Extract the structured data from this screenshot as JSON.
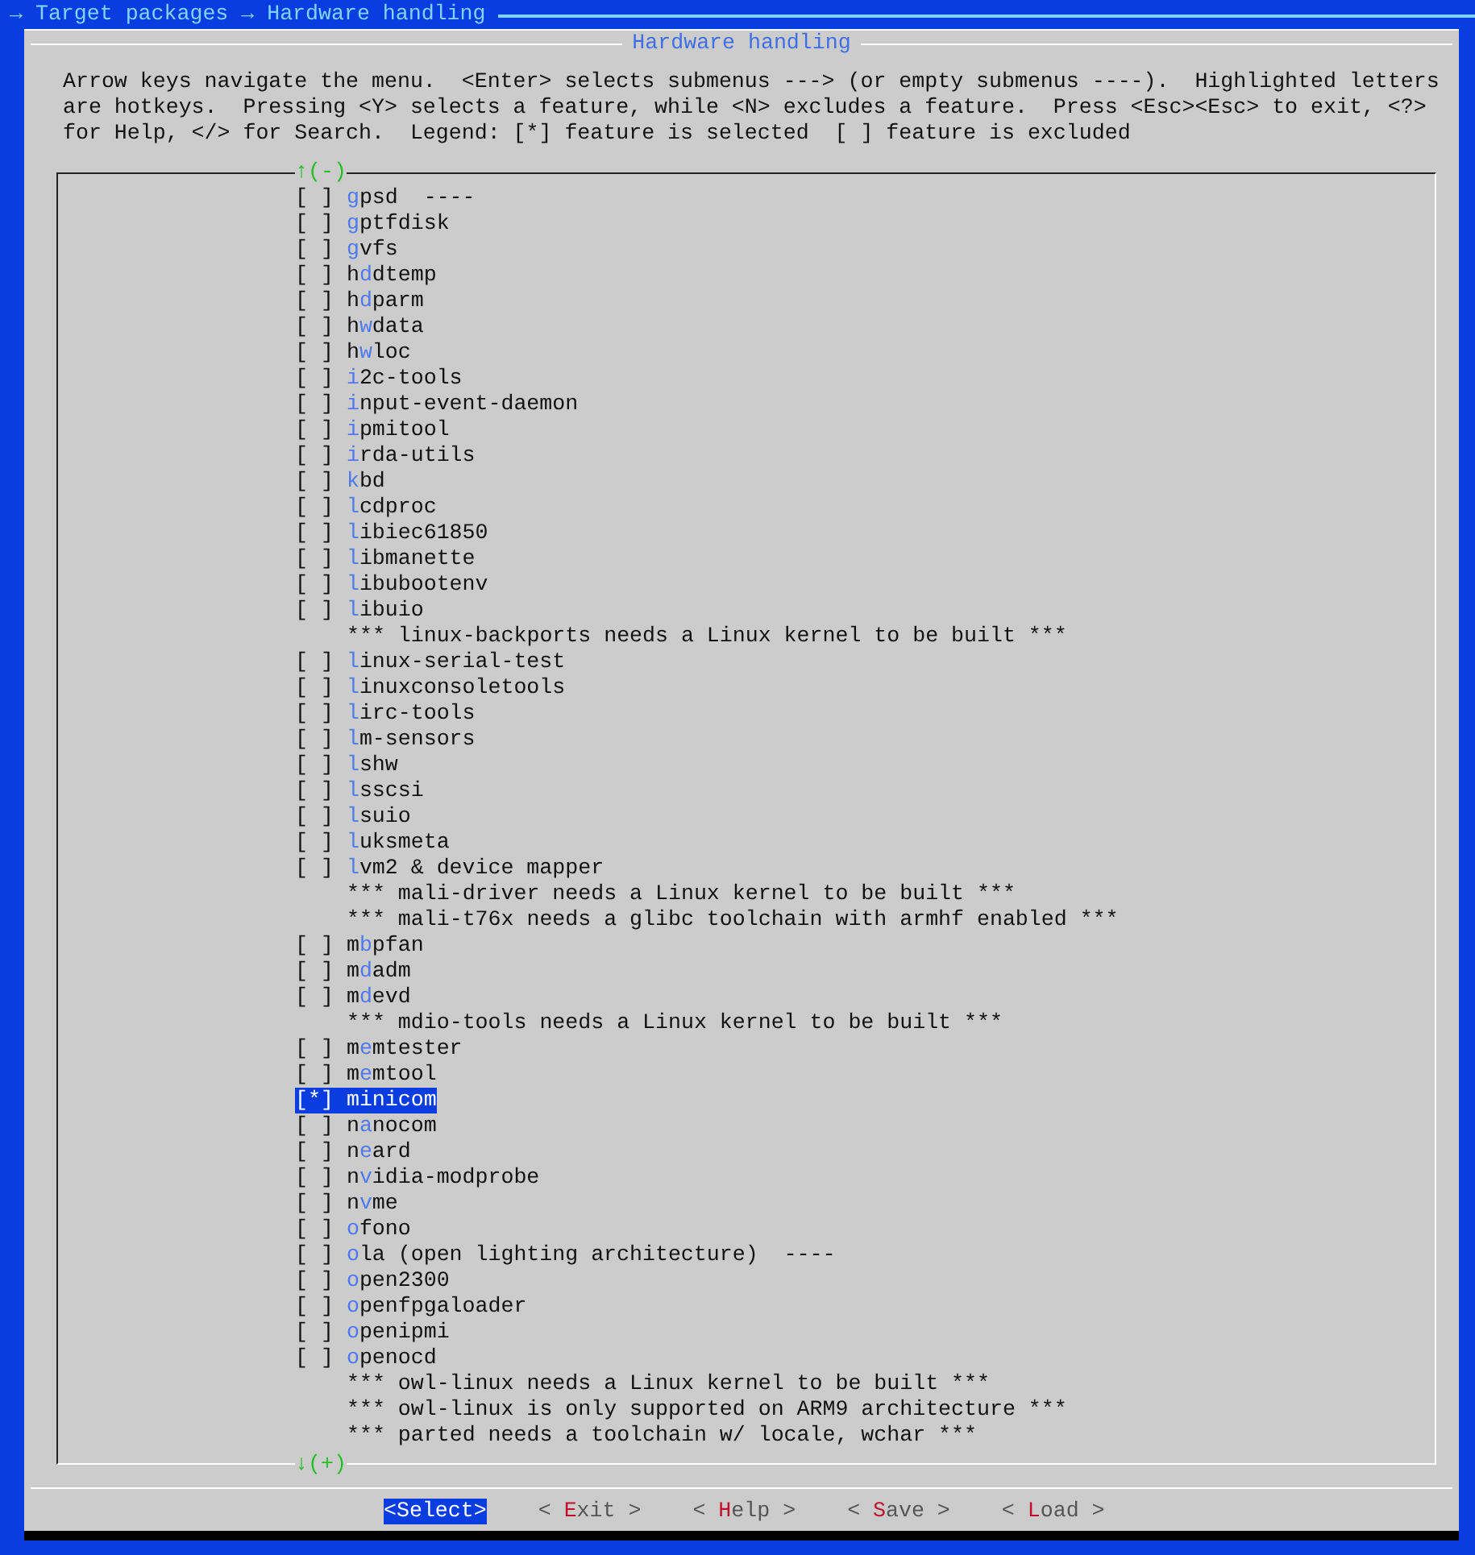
{
  "breadcrumb": "→ Target packages → Hardware handling",
  "dialog": {
    "title": "Hardware handling",
    "help_lines": [
      "Arrow keys navigate the menu.  <Enter> selects submenus ---> (or empty submenus ----).  Highlighted letters",
      "are hotkeys.  Pressing <Y> selects a feature, while <N> excludes a feature.  Press <Esc><Esc> to exit, <?>",
      "for Help, </> for Search.  Legend: [*] feature is selected  [ ] feature is excluded"
    ]
  },
  "scroll_up": "↑(-)",
  "scroll_down": "↓(+)",
  "items": [
    {
      "kind": "option",
      "checkbox": "[ ]",
      "selected": false,
      "hotkey": "g",
      "after": "psd  ----"
    },
    {
      "kind": "option",
      "checkbox": "[ ]",
      "selected": false,
      "hotkey": "g",
      "after": "ptfdisk"
    },
    {
      "kind": "option",
      "checkbox": "[ ]",
      "selected": false,
      "hotkey": "g",
      "after": "vfs"
    },
    {
      "kind": "option",
      "checkbox": "[ ]",
      "selected": false,
      "before": "h",
      "hotkey": "d",
      "after": "dtemp"
    },
    {
      "kind": "option",
      "checkbox": "[ ]",
      "selected": false,
      "before": "h",
      "hotkey": "d",
      "after": "parm"
    },
    {
      "kind": "option",
      "checkbox": "[ ]",
      "selected": false,
      "before": "h",
      "hotkey": "w",
      "after": "data"
    },
    {
      "kind": "option",
      "checkbox": "[ ]",
      "selected": false,
      "before": "h",
      "hotkey": "w",
      "after": "loc"
    },
    {
      "kind": "option",
      "checkbox": "[ ]",
      "selected": false,
      "hotkey": "i",
      "after": "2c-tools"
    },
    {
      "kind": "option",
      "checkbox": "[ ]",
      "selected": false,
      "hotkey": "i",
      "after": "nput-event-daemon"
    },
    {
      "kind": "option",
      "checkbox": "[ ]",
      "selected": false,
      "hotkey": "i",
      "after": "pmitool"
    },
    {
      "kind": "option",
      "checkbox": "[ ]",
      "selected": false,
      "hotkey": "i",
      "after": "rda-utils"
    },
    {
      "kind": "option",
      "checkbox": "[ ]",
      "selected": false,
      "hotkey": "k",
      "after": "bd"
    },
    {
      "kind": "option",
      "checkbox": "[ ]",
      "selected": false,
      "hotkey": "l",
      "after": "cdproc"
    },
    {
      "kind": "option",
      "checkbox": "[ ]",
      "selected": false,
      "hotkey": "l",
      "after": "ibiec61850"
    },
    {
      "kind": "option",
      "checkbox": "[ ]",
      "selected": false,
      "hotkey": "l",
      "after": "ibmanette"
    },
    {
      "kind": "option",
      "checkbox": "[ ]",
      "selected": false,
      "hotkey": "l",
      "after": "ibubootenv"
    },
    {
      "kind": "option",
      "checkbox": "[ ]",
      "selected": false,
      "hotkey": "l",
      "after": "ibuio"
    },
    {
      "kind": "comment",
      "text": "*** linux-backports needs a Linux kernel to be built ***"
    },
    {
      "kind": "option",
      "checkbox": "[ ]",
      "selected": false,
      "hotkey": "l",
      "after": "inux-serial-test"
    },
    {
      "kind": "option",
      "checkbox": "[ ]",
      "selected": false,
      "hotkey": "l",
      "after": "inuxconsoletools"
    },
    {
      "kind": "option",
      "checkbox": "[ ]",
      "selected": false,
      "hotkey": "l",
      "after": "irc-tools"
    },
    {
      "kind": "option",
      "checkbox": "[ ]",
      "selected": false,
      "hotkey": "l",
      "after": "m-sensors"
    },
    {
      "kind": "option",
      "checkbox": "[ ]",
      "selected": false,
      "hotkey": "l",
      "after": "shw"
    },
    {
      "kind": "option",
      "checkbox": "[ ]",
      "selected": false,
      "hotkey": "l",
      "after": "sscsi"
    },
    {
      "kind": "option",
      "checkbox": "[ ]",
      "selected": false,
      "hotkey": "l",
      "after": "suio"
    },
    {
      "kind": "option",
      "checkbox": "[ ]",
      "selected": false,
      "hotkey": "l",
      "after": "uksmeta"
    },
    {
      "kind": "option",
      "checkbox": "[ ]",
      "selected": false,
      "hotkey": "l",
      "after": "vm2 & device mapper"
    },
    {
      "kind": "comment",
      "text": "*** mali-driver needs a Linux kernel to be built ***"
    },
    {
      "kind": "comment",
      "text": "*** mali-t76x needs a glibc toolchain with armhf enabled ***"
    },
    {
      "kind": "option",
      "checkbox": "[ ]",
      "selected": false,
      "before": "m",
      "hotkey": "b",
      "after": "pfan"
    },
    {
      "kind": "option",
      "checkbox": "[ ]",
      "selected": false,
      "before": "m",
      "hotkey": "d",
      "after": "adm"
    },
    {
      "kind": "option",
      "checkbox": "[ ]",
      "selected": false,
      "before": "m",
      "hotkey": "d",
      "after": "evd"
    },
    {
      "kind": "comment",
      "text": "*** mdio-tools needs a Linux kernel to be built ***"
    },
    {
      "kind": "option",
      "checkbox": "[ ]",
      "selected": false,
      "before": "m",
      "hotkey": "e",
      "after": "mtester"
    },
    {
      "kind": "option",
      "checkbox": "[ ]",
      "selected": false,
      "before": "m",
      "hotkey": "e",
      "after": "mtool"
    },
    {
      "kind": "option",
      "checkbox": "[*]",
      "selected": true,
      "before": "m",
      "hotkey": "i",
      "after": "nicom"
    },
    {
      "kind": "option",
      "checkbox": "[ ]",
      "selected": false,
      "before": "n",
      "hotkey": "a",
      "after": "nocom"
    },
    {
      "kind": "option",
      "checkbox": "[ ]",
      "selected": false,
      "before": "n",
      "hotkey": "e",
      "after": "ard"
    },
    {
      "kind": "option",
      "checkbox": "[ ]",
      "selected": false,
      "before": "n",
      "hotkey": "v",
      "after": "idia-modprobe"
    },
    {
      "kind": "option",
      "checkbox": "[ ]",
      "selected": false,
      "before": "n",
      "hotkey": "v",
      "after": "me"
    },
    {
      "kind": "option",
      "checkbox": "[ ]",
      "selected": false,
      "hotkey": "o",
      "after": "fono"
    },
    {
      "kind": "option",
      "checkbox": "[ ]",
      "selected": false,
      "hotkey": "o",
      "after": "la (open lighting architecture)  ----"
    },
    {
      "kind": "option",
      "checkbox": "[ ]",
      "selected": false,
      "hotkey": "o",
      "after": "pen2300"
    },
    {
      "kind": "option",
      "checkbox": "[ ]",
      "selected": false,
      "hotkey": "o",
      "after": "penfpgaloader"
    },
    {
      "kind": "option",
      "checkbox": "[ ]",
      "selected": false,
      "hotkey": "o",
      "after": "penipmi"
    },
    {
      "kind": "option",
      "checkbox": "[ ]",
      "selected": false,
      "hotkey": "o",
      "after": "penocd"
    },
    {
      "kind": "comment",
      "text": "*** owl-linux needs a Linux kernel to be built ***"
    },
    {
      "kind": "comment",
      "text": "*** owl-linux is only supported on ARM9 architecture ***"
    },
    {
      "kind": "comment",
      "text": "*** parted needs a toolchain w/ locale, wchar ***"
    }
  ],
  "buttons": [
    {
      "before": "<Select>",
      "selected": true
    },
    {
      "before": "< ",
      "hotkey": "E",
      "after": "xit >",
      "selected": false
    },
    {
      "before": "< ",
      "hotkey": "H",
      "after": "elp >",
      "selected": false
    },
    {
      "before": "< ",
      "hotkey": "S",
      "after": "ave >",
      "selected": false
    },
    {
      "before": "< ",
      "hotkey": "L",
      "after": "oad >",
      "selected": false
    }
  ]
}
